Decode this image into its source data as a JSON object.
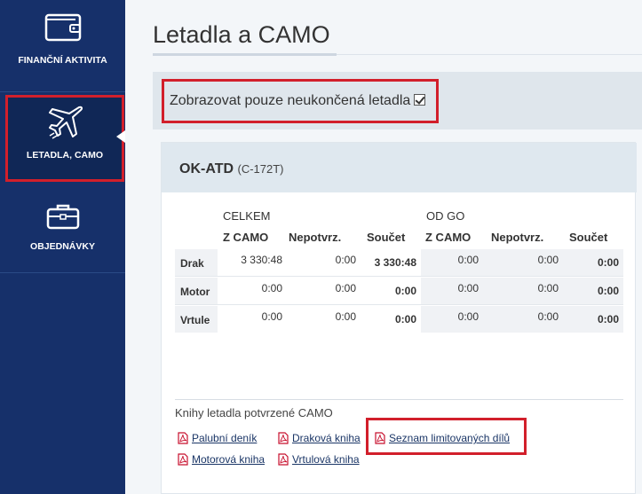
{
  "sidebar": {
    "items": [
      {
        "label": "FINANČNÍ AKTIVITA",
        "icon": "wallet-icon"
      },
      {
        "label": "LETADLA, CAMO",
        "icon": "airplane-icon",
        "active": true
      },
      {
        "label": "OBJEDNÁVKY",
        "icon": "briefcase-icon"
      }
    ]
  },
  "page": {
    "title": "Letadla a CAMO"
  },
  "filter": {
    "label": "Zobrazovat pouze neukončená letadla",
    "checked": true
  },
  "aircraft": {
    "registration": "OK-ATD",
    "type": "(C-172T)",
    "groups": [
      "CELKEM",
      "OD GO"
    ],
    "columns": [
      "Z CAMO",
      "Nepotvrz.",
      "Součet",
      "Z CAMO",
      "Nepotvrz.",
      "Součet"
    ],
    "rows": [
      {
        "label": "Drak",
        "values": [
          "3 330:48",
          "0:00",
          "3 330:48",
          "0:00",
          "0:00",
          "0:00"
        ]
      },
      {
        "label": "Motor",
        "values": [
          "0:00",
          "0:00",
          "0:00",
          "0:00",
          "0:00",
          "0:00"
        ]
      },
      {
        "label": "Vrtule",
        "values": [
          "0:00",
          "0:00",
          "0:00",
          "0:00",
          "0:00",
          "0:00"
        ]
      }
    ]
  },
  "books": {
    "title": "Knihy letadla potvrzené CAMO",
    "links": [
      "Palubní deník",
      "Draková kniha",
      "Seznam limitovaných dílů",
      "Motorová kniha",
      "Vrtulová kniha"
    ],
    "icon": "pdf-icon"
  },
  "colors": {
    "sidebar": "#16306a",
    "highlight": "#d21f2b",
    "pdf": "#c8102e"
  }
}
